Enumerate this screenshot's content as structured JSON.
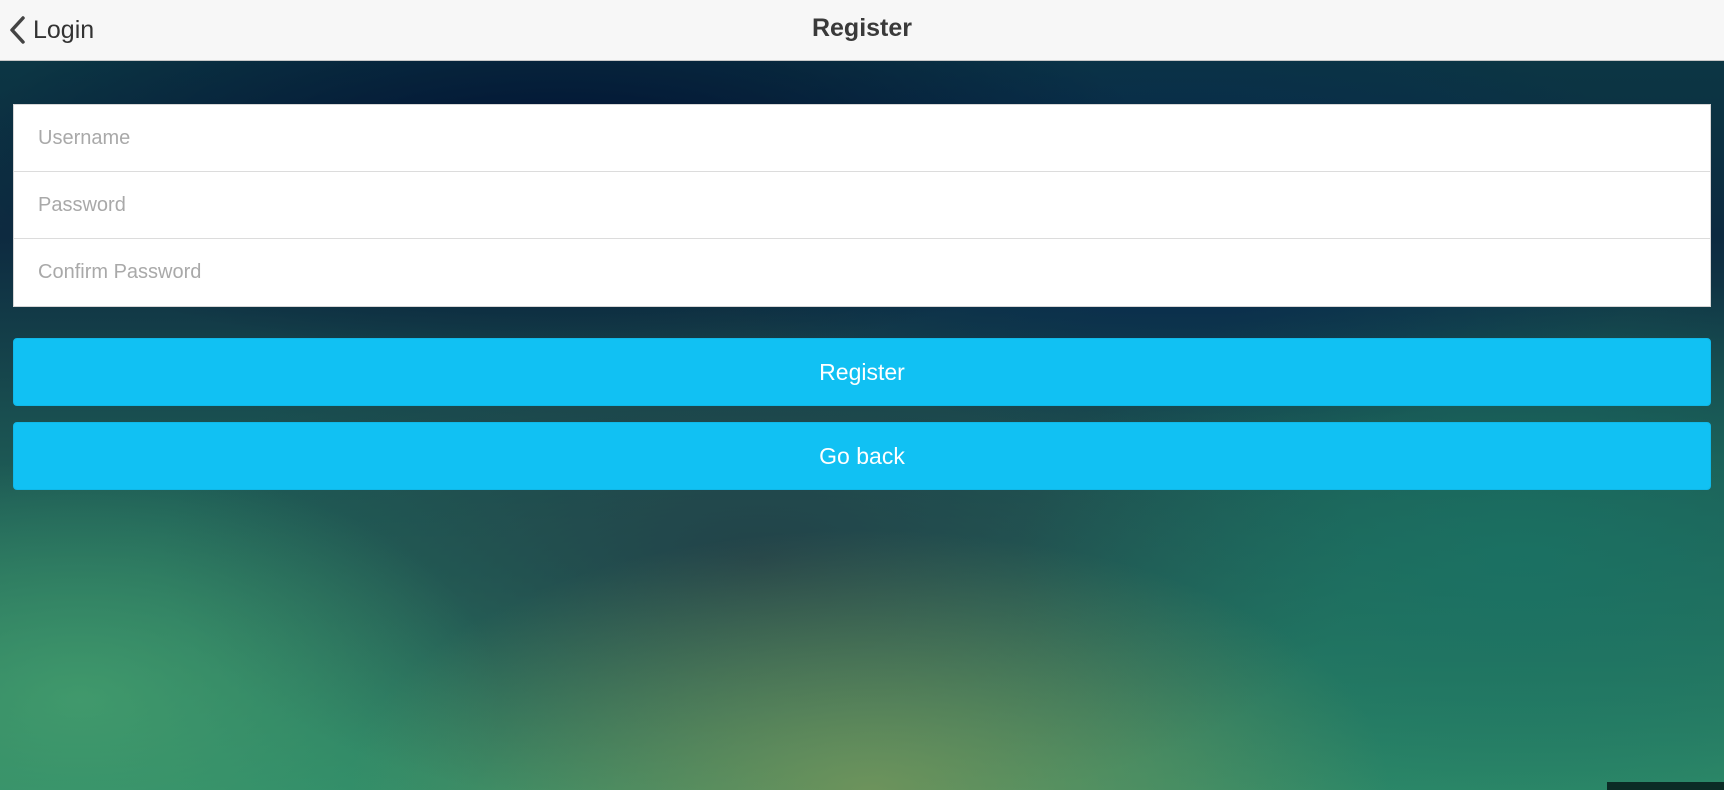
{
  "navbar": {
    "back_label": "Login",
    "title": "Register",
    "back_icon": "chevron-left-icon"
  },
  "form": {
    "username_placeholder": "Username",
    "password_placeholder": "Password",
    "confirm_placeholder": "Confirm Password"
  },
  "buttons": {
    "register_label": "Register",
    "goback_label": "Go back"
  },
  "colors": {
    "accent": "#11c1f3",
    "navbar_bg": "#f7f7f7"
  }
}
